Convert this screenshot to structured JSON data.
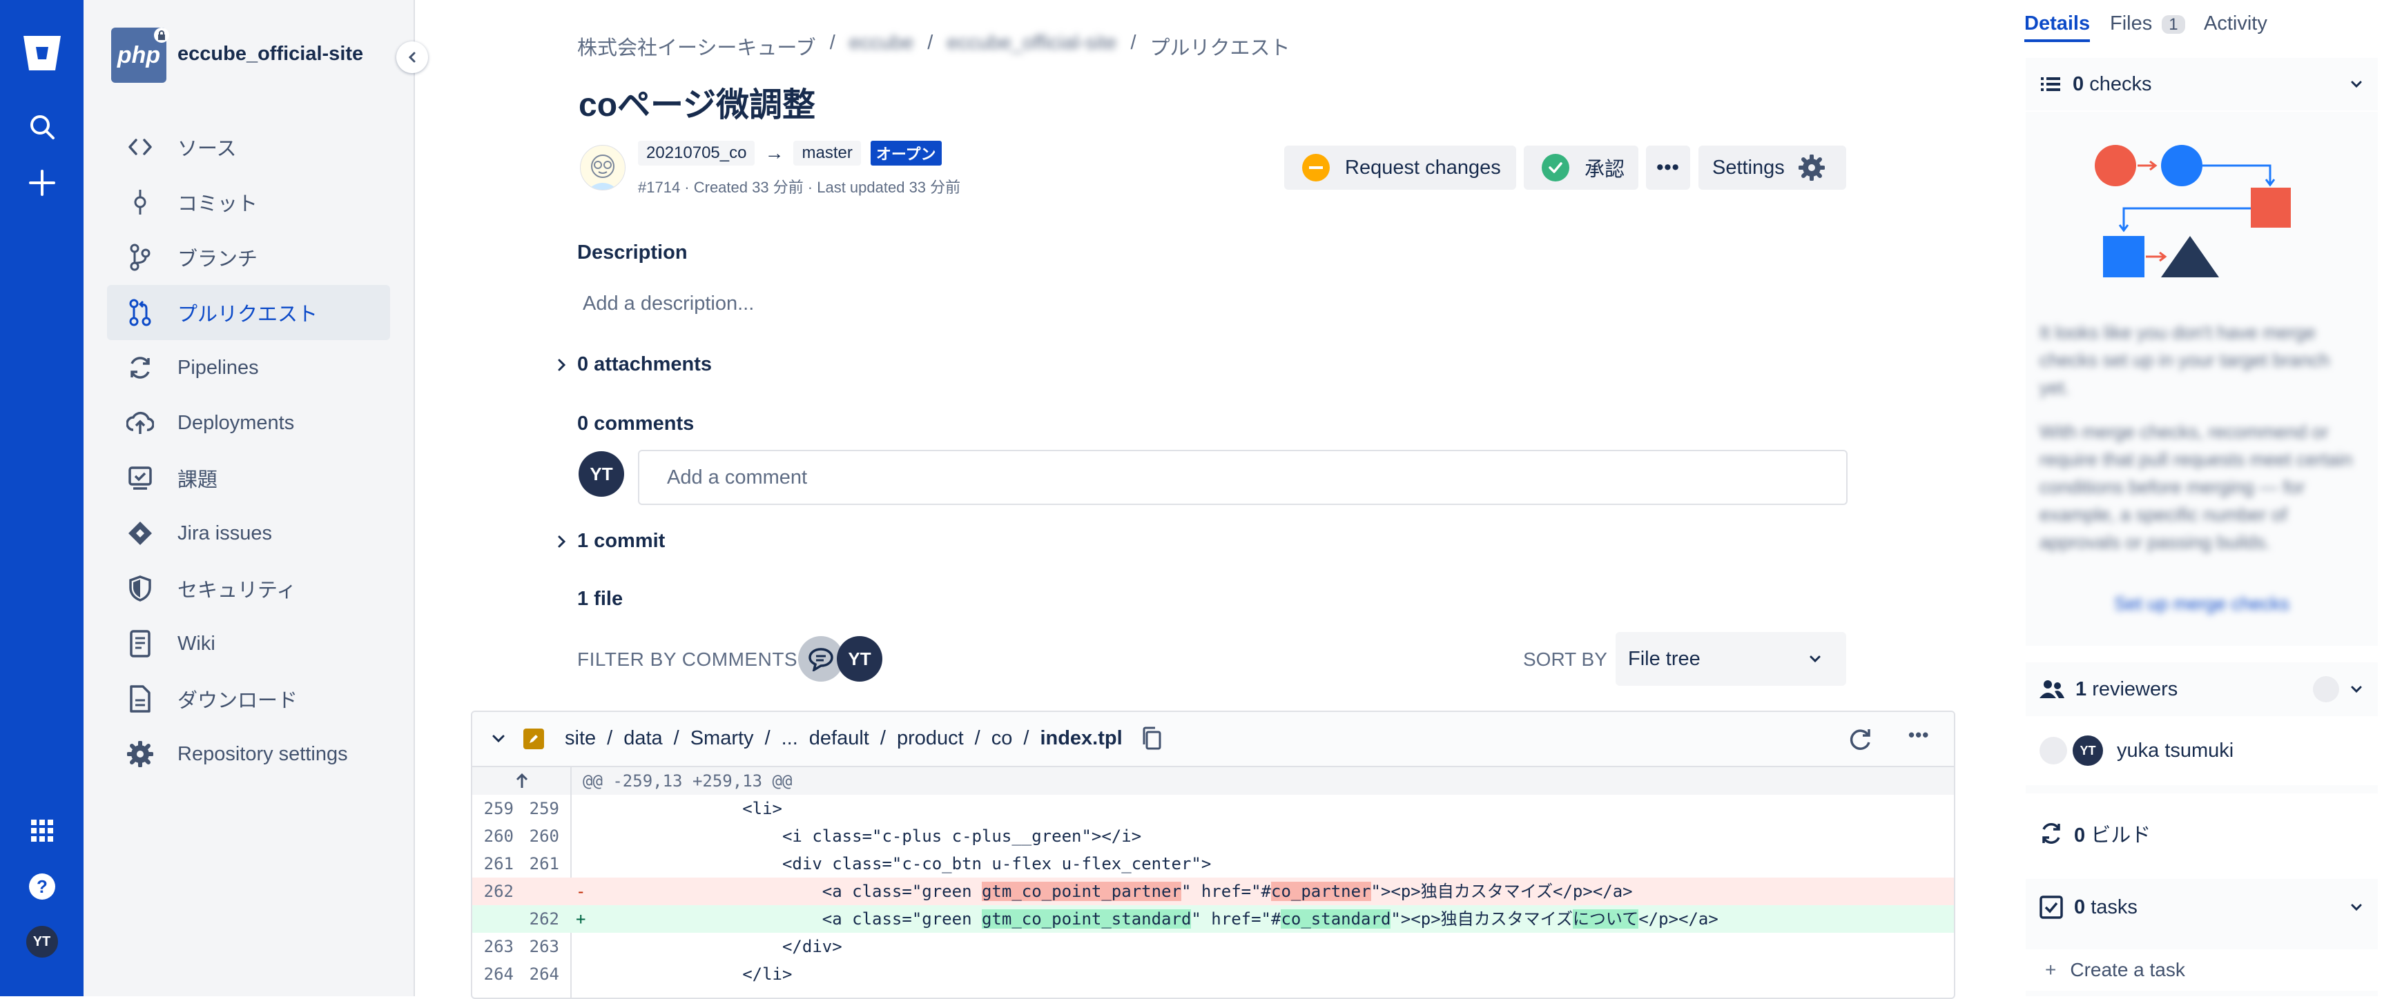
{
  "rail": {
    "avatar_initials": "YT",
    "icons": [
      "bitbucket-logo-icon",
      "search-icon",
      "plus-icon",
      "apps-grid-icon",
      "help-icon"
    ]
  },
  "sidebar": {
    "repo_name": "eccube_official-site",
    "repo_logo_text": "php",
    "items": [
      {
        "label": "ソース",
        "icon": "code-icon"
      },
      {
        "label": "コミット",
        "icon": "commit-icon"
      },
      {
        "label": "ブランチ",
        "icon": "branch-icon"
      },
      {
        "label": "プルリクエスト",
        "icon": "pull-request-icon",
        "active": true
      },
      {
        "label": "Pipelines",
        "icon": "pipelines-icon"
      },
      {
        "label": "Deployments",
        "icon": "deployments-icon"
      },
      {
        "label": "課題",
        "icon": "issues-icon"
      },
      {
        "label": "Jira issues",
        "icon": "jira-icon"
      },
      {
        "label": "セキュリティ",
        "icon": "shield-icon"
      },
      {
        "label": "Wiki",
        "icon": "wiki-icon"
      },
      {
        "label": "ダウンロード",
        "icon": "download-icon"
      },
      {
        "label": "Repository settings",
        "icon": "gear-icon"
      }
    ]
  },
  "breadcrumb": {
    "workspace": "株式会社イーシーキューブ",
    "project": "eccube",
    "repo": "eccube_official-site",
    "section": "プルリクエスト",
    "sep": "/"
  },
  "pr": {
    "title": "coページ微調整",
    "source_branch": "20210705_co",
    "arrow": "→",
    "target_branch": "master",
    "status": "オープン",
    "meta": "#1714 · Created 33 分前 · Last updated 33 分前",
    "request_changes": "Request changes",
    "approve": "承認",
    "more": "•••",
    "settings": "Settings"
  },
  "description": {
    "heading": "Description",
    "placeholder": "Add a description..."
  },
  "attachments": "0 attachments",
  "comments": {
    "heading": "0 comments",
    "placeholder": "Add a comment",
    "avatar_initials": "YT"
  },
  "commits": "1 commit",
  "files_heading": "1 file",
  "filter": {
    "label": "FILTER BY COMMENTS",
    "avatar_initials": "YT",
    "sort_label": "SORT BY",
    "sort_value": "File tree"
  },
  "diff": {
    "path": [
      "site",
      "data",
      "Smarty",
      "...",
      "default",
      "product",
      "co"
    ],
    "file": "index.tpl",
    "sep": "/",
    "hunk": "@@ -259,13 +259,13 @@",
    "lines": [
      {
        "old": "259",
        "new": "259",
        "type": "ctx",
        "text": "                <li>"
      },
      {
        "old": "260",
        "new": "260",
        "type": "ctx",
        "text": "                    <i class=\"c-plus c-plus__green\"></i>"
      },
      {
        "old": "261",
        "new": "261",
        "type": "ctx",
        "text": "                    <div class=\"c-co_btn u-flex u-flex_center\">"
      },
      {
        "old": "262",
        "new": "",
        "type": "del",
        "sign": "-",
        "pre": "                        <a class=\"green ",
        "hl1": "gtm_co_point_partner",
        "mid": "\" href=\"#",
        "hl2": "co_partner",
        "post": "\"><p>独自カスタマイズ</p></a>"
      },
      {
        "old": "",
        "new": "262",
        "type": "add",
        "sign": "+",
        "pre": "                        <a class=\"green ",
        "hl1": "gtm_co_point_standard",
        "mid": "\" href=\"#",
        "hl2": "co_standard",
        "post": "\"><p>独自カスタマイズ",
        "hl3": "について",
        "post2": "</p></a>"
      },
      {
        "old": "263",
        "new": "263",
        "type": "ctx",
        "text": "                    </div>"
      },
      {
        "old": "264",
        "new": "264",
        "type": "ctx",
        "text": "                </li>"
      }
    ]
  },
  "right_panel": {
    "tabs": [
      {
        "label": "Details",
        "active": true
      },
      {
        "label": "Files",
        "count": "1"
      },
      {
        "label": "Activity"
      }
    ],
    "checks": {
      "count": "0",
      "label": "checks"
    },
    "merge_text_1": "It looks like you don't have merge checks set up in your target branch yet.",
    "merge_text_2": "With merge checks, recommend or require that pull requests meet certain conditions before merging — for example, a specific number of approvals or passing builds.",
    "merge_link": "Set up merge checks",
    "reviewers": {
      "count": "1",
      "label": "reviewers"
    },
    "reviewer": {
      "initials": "YT",
      "name": "yuka tsumuki"
    },
    "builds": {
      "count": "0",
      "label": "ビルド"
    },
    "tasks": {
      "count": "0",
      "label": "tasks"
    },
    "create_task": "Create a task"
  },
  "colors": {
    "brand": "#0c4ac8",
    "status_badge": "#0c4ac8",
    "approve_green": "#36b37e",
    "request_changes_yellow": "#ffab00",
    "illustration_red": "#ef5c48",
    "illustration_blue": "#1d7afc"
  }
}
